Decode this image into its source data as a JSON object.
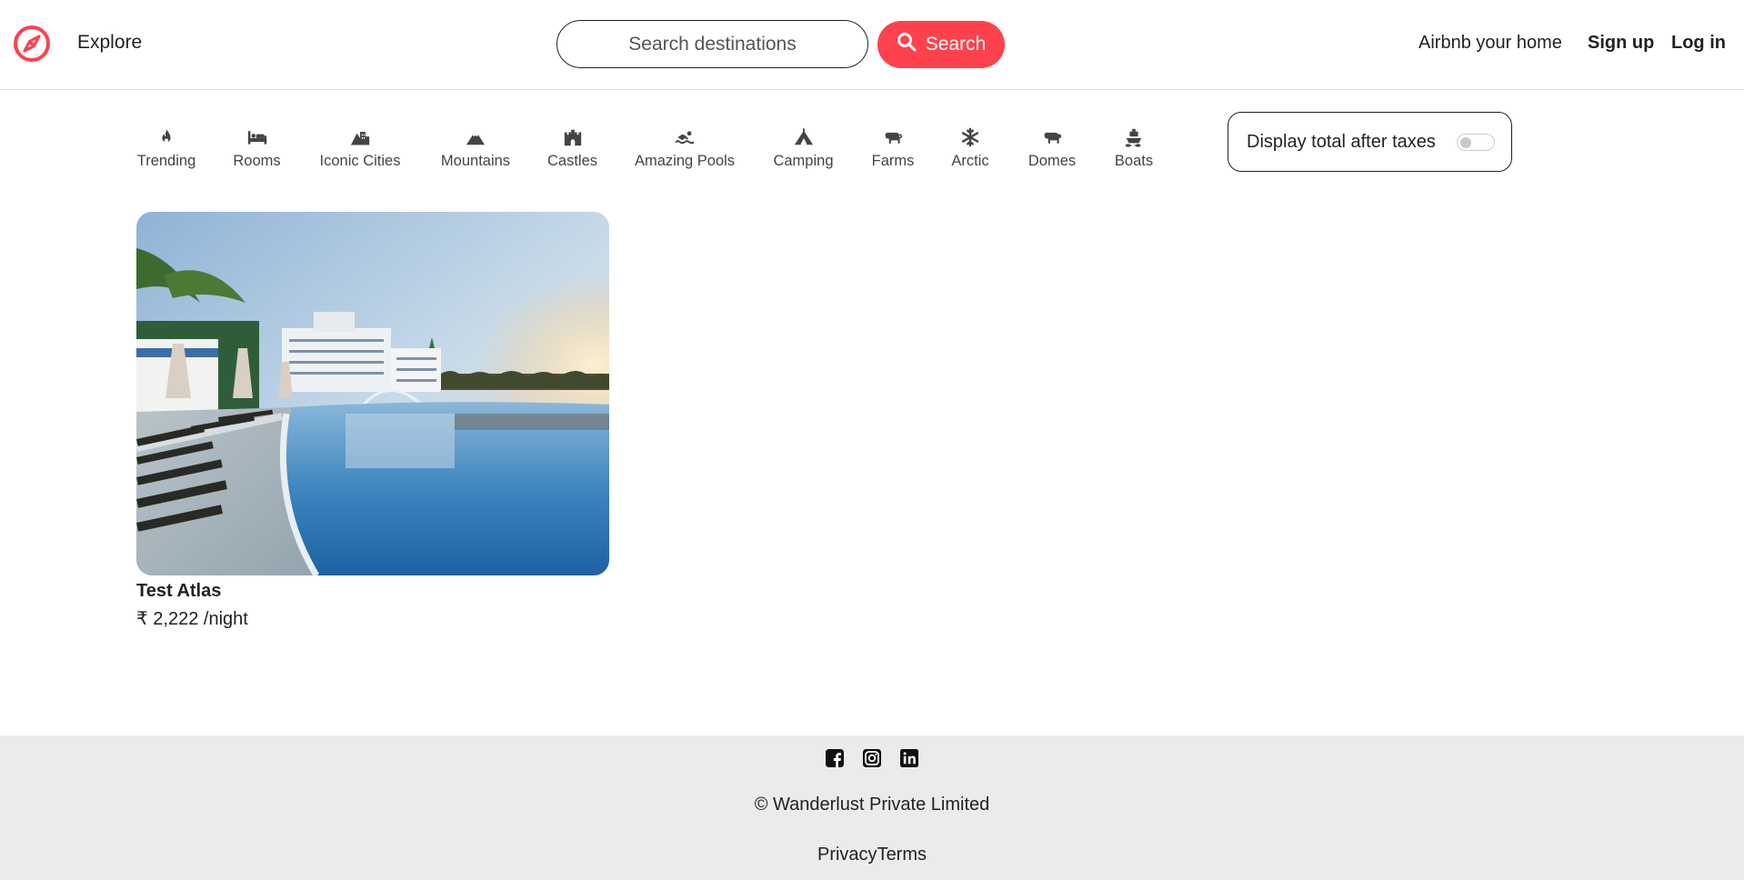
{
  "navbar": {
    "logo_icon": "compass-icon",
    "explore_label": "Explore",
    "search_placeholder": "Search destinations",
    "search_button_label": "Search",
    "search_icon": "magnifier-icon",
    "host_label": "Airbnb your home",
    "signup_label": "Sign up",
    "login_label": "Log in",
    "brand_color": "#fe424d"
  },
  "filters": [
    {
      "label": "Trending",
      "icon": "fire-icon"
    },
    {
      "label": "Rooms",
      "icon": "bed-icon"
    },
    {
      "label": "Iconic Cities",
      "icon": "mountain-city-icon"
    },
    {
      "label": "Mountains",
      "icon": "mountain-icon"
    },
    {
      "label": "Castles",
      "icon": "castle-icon"
    },
    {
      "label": "Amazing Pools",
      "icon": "person-swimming-icon"
    },
    {
      "label": "Camping",
      "icon": "campground-icon"
    },
    {
      "label": "Farms",
      "icon": "cow-icon"
    },
    {
      "label": "Arctic",
      "icon": "snowflake-icon"
    },
    {
      "label": "Domes",
      "icon": "igloo-icon"
    },
    {
      "label": "Boats",
      "icon": "ship-icon"
    }
  ],
  "tax_toggle": {
    "label": "Display total after taxes",
    "enabled": false
  },
  "listings": [
    {
      "title": "Test Atlas",
      "price": "₹ 2,222 /night",
      "image": "resort-pool-photo"
    }
  ],
  "footer": {
    "socials": [
      "facebook-icon",
      "instagram-icon",
      "linkedin-icon"
    ],
    "copyright": "© Wanderlust Private Limited",
    "links": [
      "Privacy",
      "Terms"
    ],
    "background": "#ebebeb"
  }
}
